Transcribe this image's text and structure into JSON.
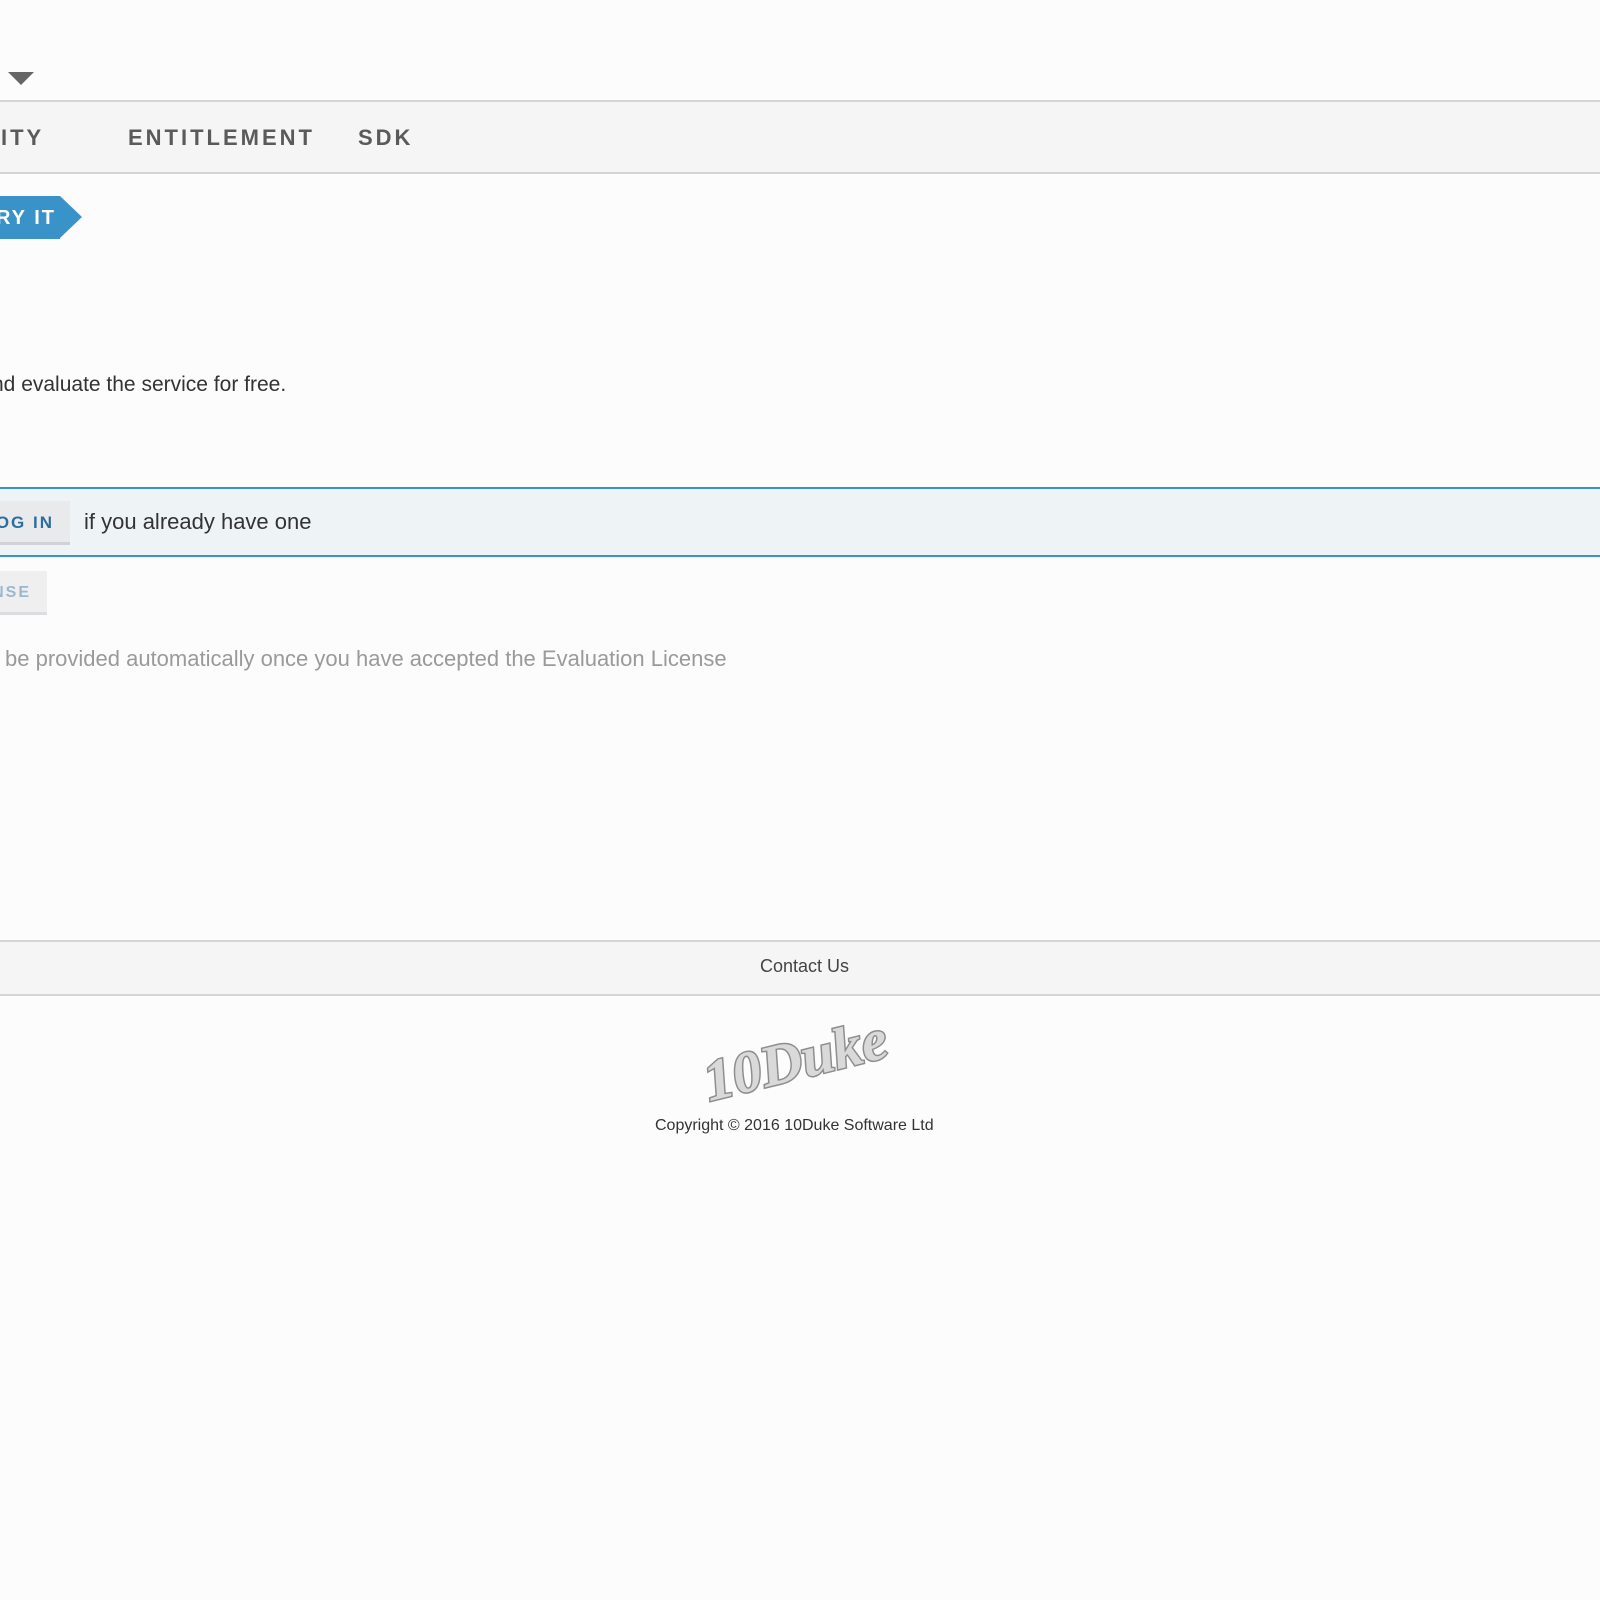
{
  "header": {
    "dropdown_icon": "chevron-down-icon"
  },
  "nav": {
    "items": [
      {
        "label": "ENTITY"
      },
      {
        "label": "ENTITLEMENT"
      },
      {
        "label": "SDK"
      }
    ]
  },
  "try_it": {
    "label": "RY IT"
  },
  "intro": {
    "text": "nd evaluate the service for free."
  },
  "login_strip": {
    "button_label": "OG IN",
    "text": "if you already have one"
  },
  "license": {
    "button_label": "NSE",
    "note": "l be provided automatically once you have accepted the Evaluation License"
  },
  "footer": {
    "contact_label": "Contact Us",
    "logo_text": "10Duke",
    "copyright": "Copyright © 2016 10Duke Software Ltd"
  },
  "colors": {
    "accent": "#3a93c8",
    "nav_text": "#5a5a5a",
    "muted_text": "#9a9a9a"
  }
}
